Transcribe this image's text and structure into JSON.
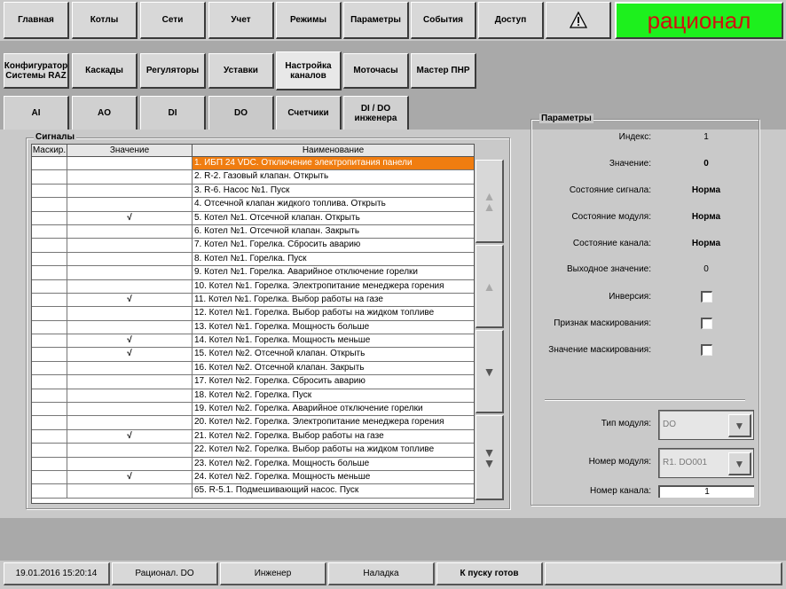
{
  "top_nav": [
    "Главная",
    "Котлы",
    "Сети",
    "Учет",
    "Режимы",
    "Параметры",
    "События",
    "Доступ"
  ],
  "brand": "рационал",
  "sub_nav": [
    {
      "label": "Конфигуратор\nСистемы RAZ"
    },
    {
      "label": "Каскады"
    },
    {
      "label": "Регуляторы"
    },
    {
      "label": "Уставки"
    },
    {
      "label": "Настройка\nканалов"
    },
    {
      "label": "Моточасы"
    },
    {
      "label": "Мастер ПНР"
    }
  ],
  "channel_tabs": [
    "AI",
    "AO",
    "DI",
    "DO",
    "Счетчики",
    "DI / DO\nинженера"
  ],
  "signals": {
    "title": "Сигналы",
    "columns": [
      "Маскир.",
      "Значение",
      "Наименование"
    ],
    "rows": [
      {
        "mask": "",
        "value": "",
        "name": "1. ИБП 24 VDC. Отключение электропитания панели",
        "selected": true
      },
      {
        "mask": "",
        "value": "",
        "name": "2. R-2. Газовый клапан. Открыть"
      },
      {
        "mask": "",
        "value": "",
        "name": "3. R-6. Насос №1. Пуск"
      },
      {
        "mask": "",
        "value": "",
        "name": "4. Отсечной клапан жидкого топлива. Открыть"
      },
      {
        "mask": "",
        "value": "√",
        "name": "5. Котел №1. Отсечной клапан. Открыть"
      },
      {
        "mask": "",
        "value": "",
        "name": "6. Котел №1. Отсечной клапан. Закрыть"
      },
      {
        "mask": "",
        "value": "",
        "name": "7. Котел №1. Горелка. Сбросить аварию"
      },
      {
        "mask": "",
        "value": "",
        "name": "8. Котел №1. Горелка. Пуск"
      },
      {
        "mask": "",
        "value": "",
        "name": "9. Котел №1. Горелка. Аварийное отключение горелки"
      },
      {
        "mask": "",
        "value": "",
        "name": "10. Котел №1. Горелка. Электропитание менеджера горения"
      },
      {
        "mask": "",
        "value": "√",
        "name": "11. Котел №1. Горелка. Выбор работы на газе"
      },
      {
        "mask": "",
        "value": "",
        "name": "12. Котел №1. Горелка. Выбор работы на жидком топливе"
      },
      {
        "mask": "",
        "value": "",
        "name": "13. Котел №1. Горелка. Мощность больше"
      },
      {
        "mask": "",
        "value": "√",
        "name": "14. Котел №1. Горелка. Мощность меньше"
      },
      {
        "mask": "",
        "value": "√",
        "name": "15. Котел №2. Отсечной клапан. Открыть"
      },
      {
        "mask": "",
        "value": "",
        "name": "16. Котел №2. Отсечной клапан. Закрыть"
      },
      {
        "mask": "",
        "value": "",
        "name": "17. Котел №2. Горелка. Сбросить аварию"
      },
      {
        "mask": "",
        "value": "",
        "name": "18. Котел №2. Горелка. Пуск"
      },
      {
        "mask": "",
        "value": "",
        "name": "19. Котел №2. Горелка. Аварийное отключение горелки"
      },
      {
        "mask": "",
        "value": "",
        "name": "20. Котел №2. Горелка. Электропитание менеджера горения"
      },
      {
        "mask": "",
        "value": "√",
        "name": "21. Котел №2. Горелка. Выбор работы на газе"
      },
      {
        "mask": "",
        "value": "",
        "name": "22. Котел №2. Горелка. Выбор работы на жидком топливе"
      },
      {
        "mask": "",
        "value": "",
        "name": "23. Котел №2. Горелка. Мощность больше"
      },
      {
        "mask": "",
        "value": "√",
        "name": "24. Котел №2. Горелка. Мощность меньше"
      },
      {
        "mask": "",
        "value": "",
        "name": "65. R-5.1. Подмешивающий насос. Пуск"
      }
    ]
  },
  "params": {
    "title": "Параметры",
    "index_label": "Индекс:",
    "index_value": "1",
    "value_label": "Значение:",
    "value_value": "0",
    "signal_state_label": "Состояние сигнала:",
    "signal_state_value": "Норма",
    "module_state_label": "Состояние модуля:",
    "module_state_value": "Норма",
    "channel_state_label": "Состояние канала:",
    "channel_state_value": "Норма",
    "output_value_label": "Выходное значение:",
    "output_value_value": "0",
    "inversion_label": "Инверсия:",
    "mask_flag_label": "Признак маскирования:",
    "mask_value_label": "Значение маскирования:",
    "module_type_label": "Тип модуля:",
    "module_type_value": "DO",
    "module_number_label": "Номер модуля:",
    "module_number_value": "R1. DO001",
    "channel_number_label": "Номер канала:",
    "channel_number_value": "1"
  },
  "status_bar": {
    "datetime": "19.01.2016 15:20:14",
    "screen": "Рационал. DO",
    "user": "Инженер",
    "mode": "Наладка",
    "state": "К пуску готов"
  }
}
